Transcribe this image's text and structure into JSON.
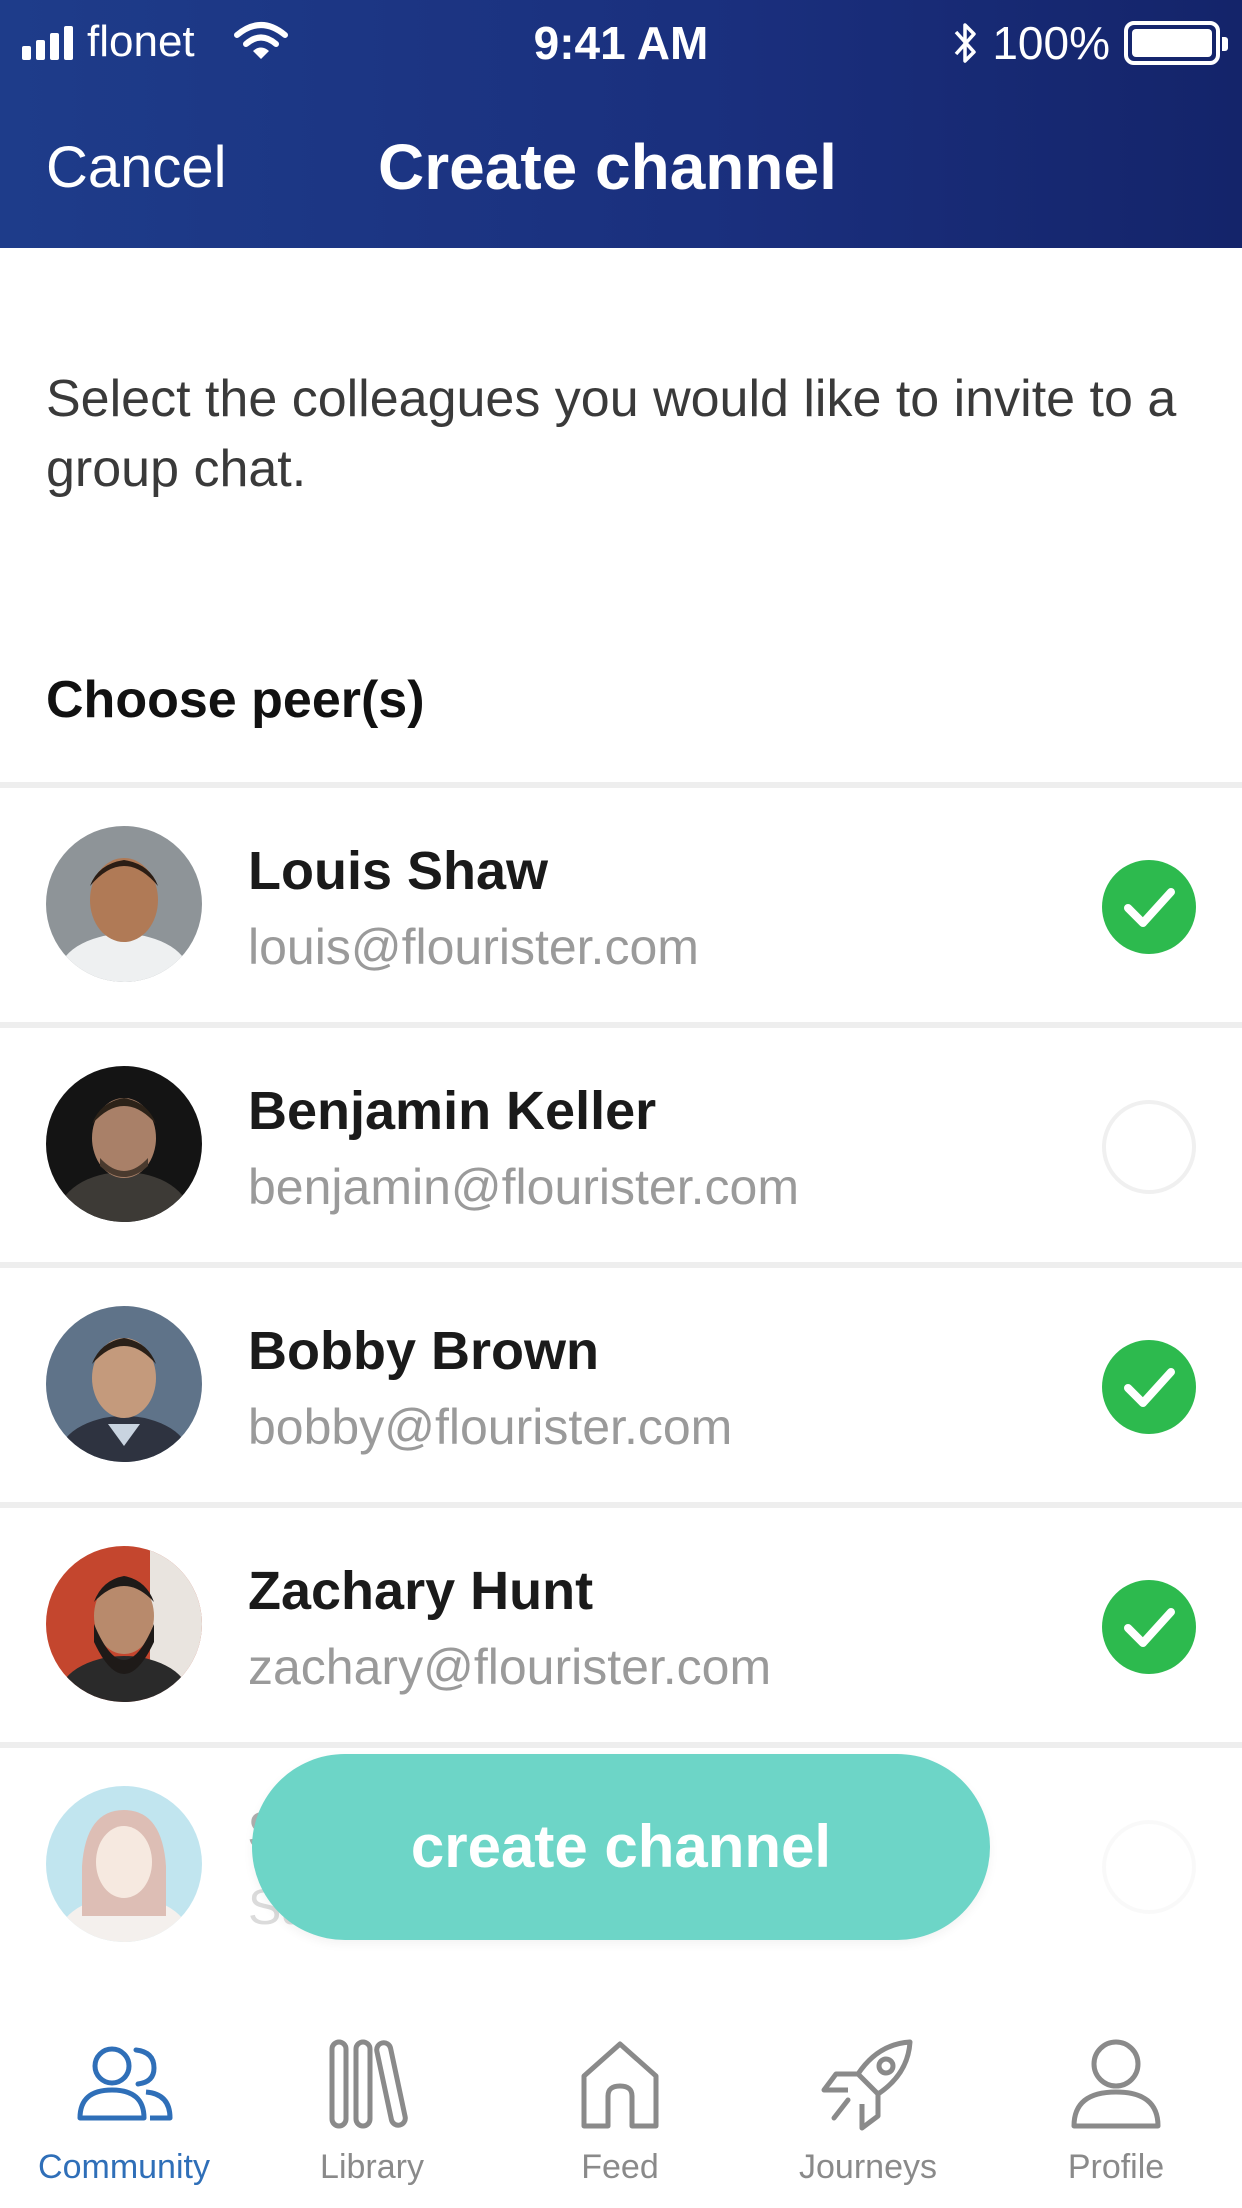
{
  "status_bar": {
    "carrier": "flonet",
    "time": "9:41 AM",
    "battery": "100%"
  },
  "header": {
    "cancel_label": "Cancel",
    "title": "Create channel"
  },
  "intro_text": "Select the colleagues you would like to invite to a group chat.",
  "section_title": "Choose peer(s)",
  "peers": [
    {
      "name": "Louis Shaw",
      "email": "louis@flourister.com",
      "selected": true
    },
    {
      "name": "Benjamin Keller",
      "email": "benjamin@flourister.com",
      "selected": false
    },
    {
      "name": "Bobby Brown",
      "email": "bobby@flourister.com",
      "selected": true
    },
    {
      "name": "Zachary Hunt",
      "email": "zachary@flourister.com",
      "selected": true
    },
    {
      "name": "S",
      "email": "Sa",
      "selected": false
    }
  ],
  "create_button_label": "create channel",
  "tabs": [
    {
      "label": "Community",
      "icon": "community-icon",
      "active": true
    },
    {
      "label": "Library",
      "icon": "library-icon",
      "active": false
    },
    {
      "label": "Feed",
      "icon": "home-icon",
      "active": false
    },
    {
      "label": "Journeys",
      "icon": "rocket-icon",
      "active": false
    },
    {
      "label": "Profile",
      "icon": "profile-icon",
      "active": false
    }
  ],
  "colors": {
    "header_blue": "#1a2f7d",
    "check_green": "#2dba4e",
    "button_teal": "#6dd5c7",
    "active_tab_blue": "#2f6fb8"
  }
}
